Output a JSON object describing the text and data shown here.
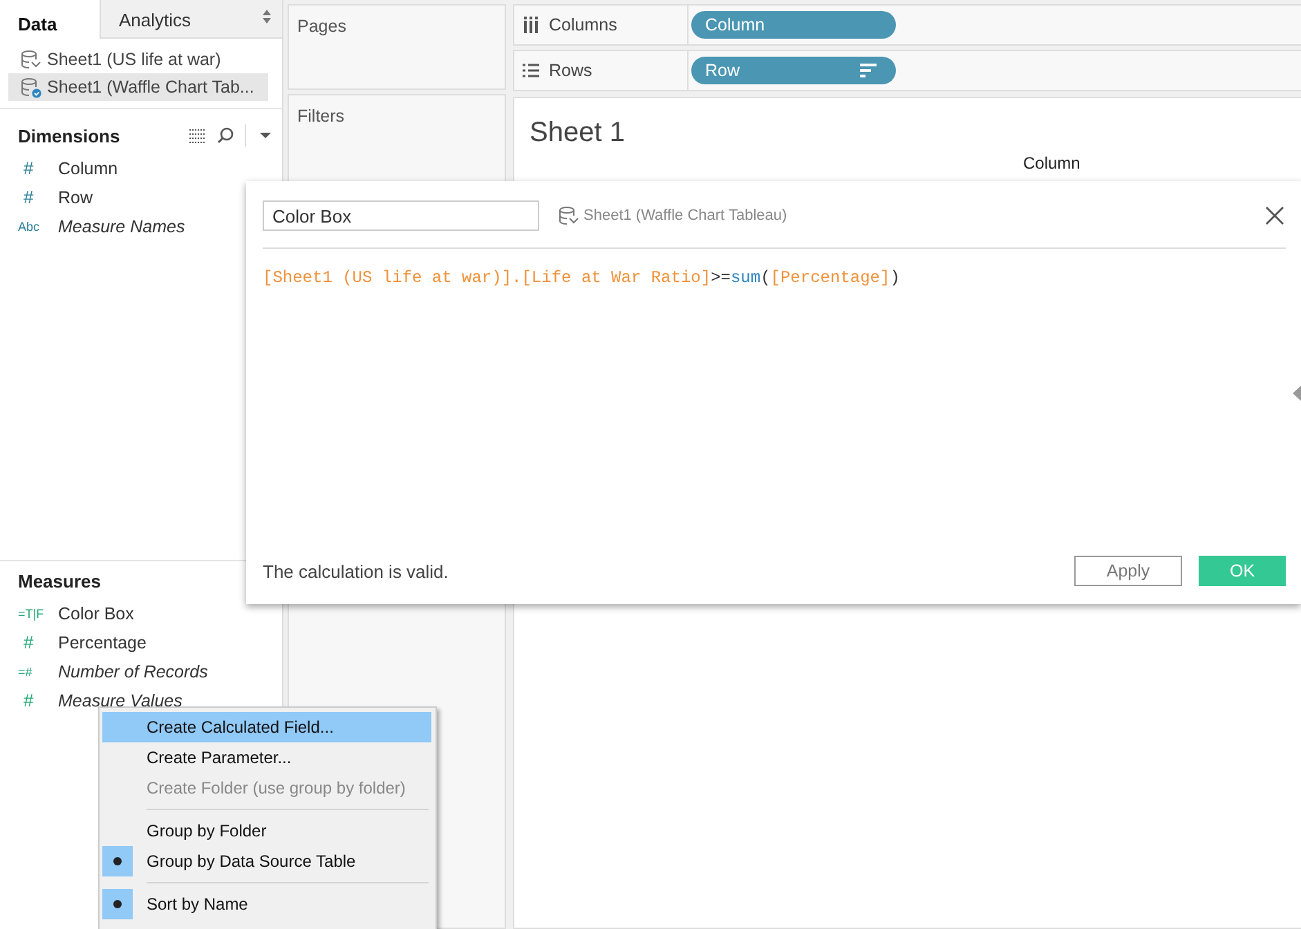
{
  "sidebar": {
    "tabs": [
      {
        "label": "Data",
        "selected": true
      },
      {
        "label": "Analytics",
        "selected": false
      }
    ],
    "data_sources": [
      {
        "label": "Sheet1 (US life at war)",
        "selected": false,
        "primary": false
      },
      {
        "label": "Sheet1 (Waffle Chart Tab...",
        "selected": true,
        "primary": true
      }
    ],
    "sections": [
      {
        "title": "Dimensions",
        "kind": "dimension",
        "tools": true,
        "fields": [
          {
            "icon": "#",
            "label": "Column",
            "generated": false
          },
          {
            "icon": "#",
            "label": "Row",
            "generated": false
          },
          {
            "icon": "Abc",
            "label": "Measure Names",
            "generated": true
          }
        ]
      },
      {
        "title": "Measures",
        "kind": "measure",
        "tools": false,
        "fields": [
          {
            "icon": "=T|F",
            "label": "Color Box",
            "generated": false
          },
          {
            "icon": "#",
            "label": "Percentage",
            "generated": false
          },
          {
            "icon": "=#",
            "label": "Number of Records",
            "generated": true
          },
          {
            "icon": "#",
            "label": "Measure Values",
            "generated": true
          }
        ]
      }
    ]
  },
  "cards": [
    {
      "title": "Pages"
    },
    {
      "title": "Filters"
    }
  ],
  "shelves": [
    {
      "label": "Columns",
      "kind": "columns",
      "pills": [
        {
          "label": "Column",
          "sorted": false
        }
      ]
    },
    {
      "label": "Rows",
      "kind": "rows",
      "pills": [
        {
          "label": "Row",
          "sorted": true
        }
      ]
    }
  ],
  "sheet": {
    "title": "Sheet 1",
    "column_header": "Column"
  },
  "dialog": {
    "name_value": "Color Box",
    "data_source": "Sheet1 (Waffle Chart Tableau)",
    "formula": [
      {
        "kind": "field",
        "text": "[Sheet1 (US life at war)].[Life at War Ratio]"
      },
      {
        "kind": "operator",
        "text": ">="
      },
      {
        "kind": "function",
        "text": "sum"
      },
      {
        "kind": "operator",
        "text": "("
      },
      {
        "kind": "field",
        "text": "[Percentage]"
      },
      {
        "kind": "operator",
        "text": ")"
      }
    ],
    "status": "The calculation is valid.",
    "buttons": [
      {
        "label": "Apply",
        "kind": "secondary"
      },
      {
        "label": "OK",
        "kind": "primary"
      }
    ]
  },
  "context_menu": {
    "items": [
      {
        "kind": "item",
        "label": "Create Calculated Field...",
        "selected": true,
        "disabled": false,
        "checked": false
      },
      {
        "kind": "item",
        "label": "Create Parameter...",
        "selected": false,
        "disabled": false,
        "checked": false
      },
      {
        "kind": "item",
        "label": "Create Folder (use group by folder)",
        "selected": false,
        "disabled": true,
        "checked": false
      },
      {
        "kind": "separator"
      },
      {
        "kind": "item",
        "label": "Group by Folder",
        "selected": false,
        "disabled": false,
        "checked": false
      },
      {
        "kind": "item",
        "label": "Group by Data Source Table",
        "selected": false,
        "disabled": false,
        "checked": true
      },
      {
        "kind": "separator"
      },
      {
        "kind": "item",
        "label": "Sort by Name",
        "selected": false,
        "disabled": false,
        "checked": true
      }
    ]
  }
}
